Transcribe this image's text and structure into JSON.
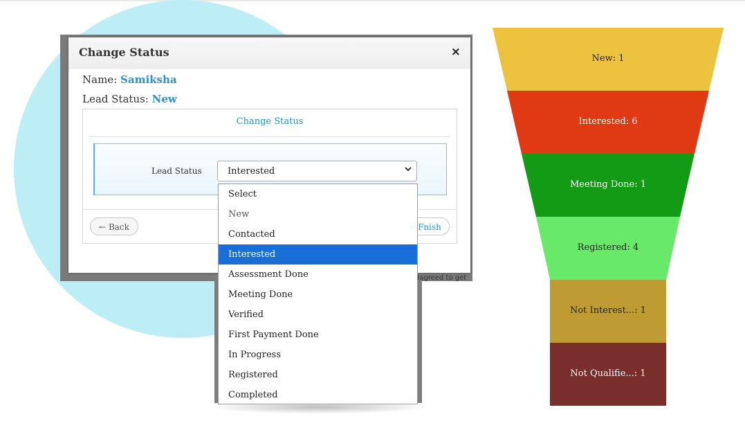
{
  "modal": {
    "title": "Change Status",
    "close": "×",
    "name_label": "Name:",
    "name_value": "Samiksha",
    "status_label": "Lead Status:",
    "status_value": "New",
    "panel_title": "Change Status",
    "field_label": "Lead Status",
    "select_value": "Interested",
    "chevron": "⌄",
    "back_label": "← Back",
    "finish_label": "Fnish"
  },
  "dropdown": {
    "options": [
      "Select",
      "New",
      "Contacted",
      "Interested",
      "Assessment Done",
      "Meeting Done",
      "Verified",
      "First Payment Done",
      "In Progress",
      "Registered",
      "Completed"
    ],
    "selected": "Interested",
    "disabled": [
      "New"
    ]
  },
  "backdrop": {
    "snippet": "dagreed to get"
  },
  "funnel": {
    "stages": [
      {
        "label": "New: 1",
        "color": "#ecc23f"
      },
      {
        "label": "Interested: 6",
        "color": "#df3a14"
      },
      {
        "label": "Meeting Done: 1",
        "color": "#139b16"
      },
      {
        "label": "Registered: 4",
        "color": "#68e96a"
      },
      {
        "label": "Not Interest...: 1",
        "color": "#be9c33"
      },
      {
        "label": "Not Qualifie...: 1",
        "color": "#7a2e2c"
      }
    ],
    "label_colors": [
      "#222222",
      "#ffffff",
      "#ffffff",
      "#222222",
      "#222222",
      "#ffffff"
    ]
  },
  "colors": {
    "accent": "#2f8fc9",
    "selected_option": "#1a6ed8",
    "circle": "#bdeef6"
  }
}
